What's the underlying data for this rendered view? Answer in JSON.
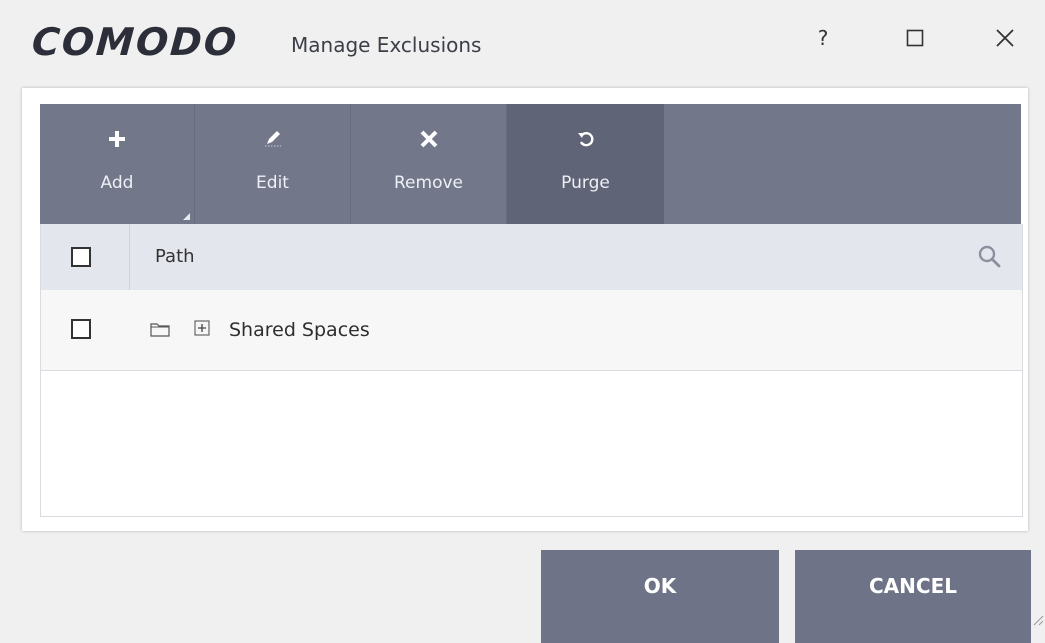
{
  "window": {
    "logo_text": "COMODO",
    "title": "Manage Exclusions",
    "help_glyph": "?",
    "maximize_glyph": "☐",
    "close_glyph": "✕"
  },
  "toolbar": {
    "items": [
      {
        "label": "Add",
        "icon": "plus-icon"
      },
      {
        "label": "Edit",
        "icon": "pencil-icon"
      },
      {
        "label": "Remove",
        "icon": "x-icon"
      },
      {
        "label": "Purge",
        "icon": "refresh-icon"
      }
    ]
  },
  "table": {
    "columns": [
      "Path"
    ],
    "rows": [
      {
        "name": "Shared Spaces",
        "checked": false,
        "expandable": true
      }
    ]
  },
  "footer": {
    "ok_label": "OK",
    "cancel_label": "CANCEL"
  },
  "colors": {
    "toolbar_bg": "#72778a",
    "toolbar_active_bg": "#5f6477",
    "button_bg": "#6e7387",
    "header_bg": "#e4e6ed"
  }
}
